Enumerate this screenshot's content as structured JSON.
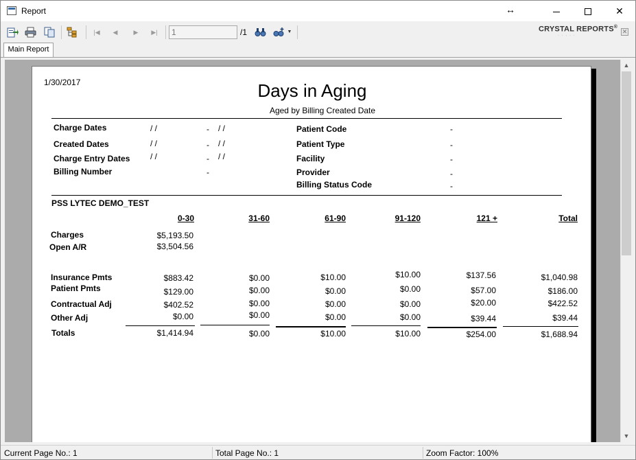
{
  "window": {
    "title": "Report"
  },
  "toolbar": {
    "page_number": "1",
    "page_total": "/1",
    "brand": "CRYSTAL REPORTS",
    "brand_mark": "®",
    "tools": [
      "export-icon",
      "print-icon",
      "copy-icon",
      "group-tree-icon",
      "first-page-icon",
      "previous-page-icon",
      "next-page-icon",
      "last-page-icon",
      "find-icon",
      "zoom-icon"
    ]
  },
  "tabs": [
    {
      "label": "Main Report"
    }
  ],
  "report": {
    "date": "1/30/2017",
    "title": "Days in Aging",
    "subtitle": "Aged by Billing Created Date",
    "filters_left": [
      {
        "label": "Charge Dates",
        "from": "/ /",
        "sep": "-",
        "to": "/ /"
      },
      {
        "label": "Created Dates",
        "from": "/ /",
        "sep": "-",
        "to": "/ /"
      },
      {
        "label": "Charge Entry Dates",
        "from": "/ /",
        "sep": "-",
        "to": "/ /"
      },
      {
        "label": "Billing Number",
        "from": "",
        "sep": "-",
        "to": ""
      }
    ],
    "filters_right": [
      {
        "label": "Patient Code",
        "value": "-"
      },
      {
        "label": "Patient Type",
        "value": "-"
      },
      {
        "label": "Facility",
        "value": "-"
      },
      {
        "label": "Provider",
        "value": "-"
      },
      {
        "label": "Billing Status Code",
        "value": "-"
      }
    ],
    "practice": "PSS LYTEC DEMO_TEST",
    "columns": [
      "0-30",
      "31-60",
      "61-90",
      "91-120",
      "121 +",
      "Total"
    ],
    "charges": {
      "label": "Charges",
      "value": "$5,193.50"
    },
    "open_ar": {
      "label": "Open A/R",
      "value": "$3,504.56"
    },
    "rows": [
      {
        "label": "Insurance Pmts",
        "values": [
          "$883.42",
          "$0.00",
          "$10.00",
          "$10.00",
          "$137.56",
          "$1,040.98"
        ]
      },
      {
        "label": "Patient Pmts",
        "values": [
          "$129.00",
          "$0.00",
          "$0.00",
          "$0.00",
          "$57.00",
          "$186.00"
        ]
      },
      {
        "label": "Contractual Adj",
        "values": [
          "$402.52",
          "$0.00",
          "$0.00",
          "$0.00",
          "$20.00",
          "$422.52"
        ]
      },
      {
        "label": "Other Adj",
        "values": [
          "$0.00",
          "$0.00",
          "$0.00",
          "$0.00",
          "$39.44",
          "$39.44"
        ]
      }
    ],
    "totals": {
      "label": "Totals",
      "values": [
        "$1,414.94",
        "$0.00",
        "$10.00",
        "$10.00",
        "$254.00",
        "$1,688.94"
      ]
    }
  },
  "status": {
    "current_page": "Current Page No.: 1",
    "total_page": "Total Page No.: 1",
    "zoom": "Zoom Factor: 100%"
  }
}
